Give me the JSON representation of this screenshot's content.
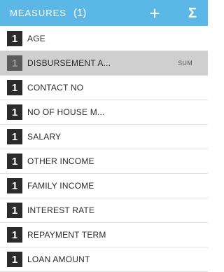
{
  "header": {
    "title": "MEASURES",
    "count": "(1)",
    "add_icon": "plus-icon",
    "sum_icon": "sigma-icon"
  },
  "colors": {
    "header_bg": "#5bb7e5",
    "selected_row_bg": "#cfcfcf",
    "badge_bg": "#2b2b2b"
  },
  "measures": [
    {
      "badge": "1",
      "label": "AGE",
      "aggregation": ""
    },
    {
      "badge": "1",
      "label": "DISBURSEMENT A...",
      "aggregation": "SUM",
      "selected": true
    },
    {
      "badge": "1",
      "label": "CONTACT NO",
      "aggregation": ""
    },
    {
      "badge": "1",
      "label": "NO OF HOUSE M...",
      "aggregation": ""
    },
    {
      "badge": "1",
      "label": "SALARY",
      "aggregation": ""
    },
    {
      "badge": "1",
      "label": "OTHER INCOME",
      "aggregation": ""
    },
    {
      "badge": "1",
      "label": "FAMILY INCOME",
      "aggregation": ""
    },
    {
      "badge": "1",
      "label": "INTEREST RATE",
      "aggregation": ""
    },
    {
      "badge": "1",
      "label": "REPAYMENT TERM",
      "aggregation": ""
    },
    {
      "badge": "1",
      "label": "LOAN AMOUNT",
      "aggregation": ""
    }
  ]
}
